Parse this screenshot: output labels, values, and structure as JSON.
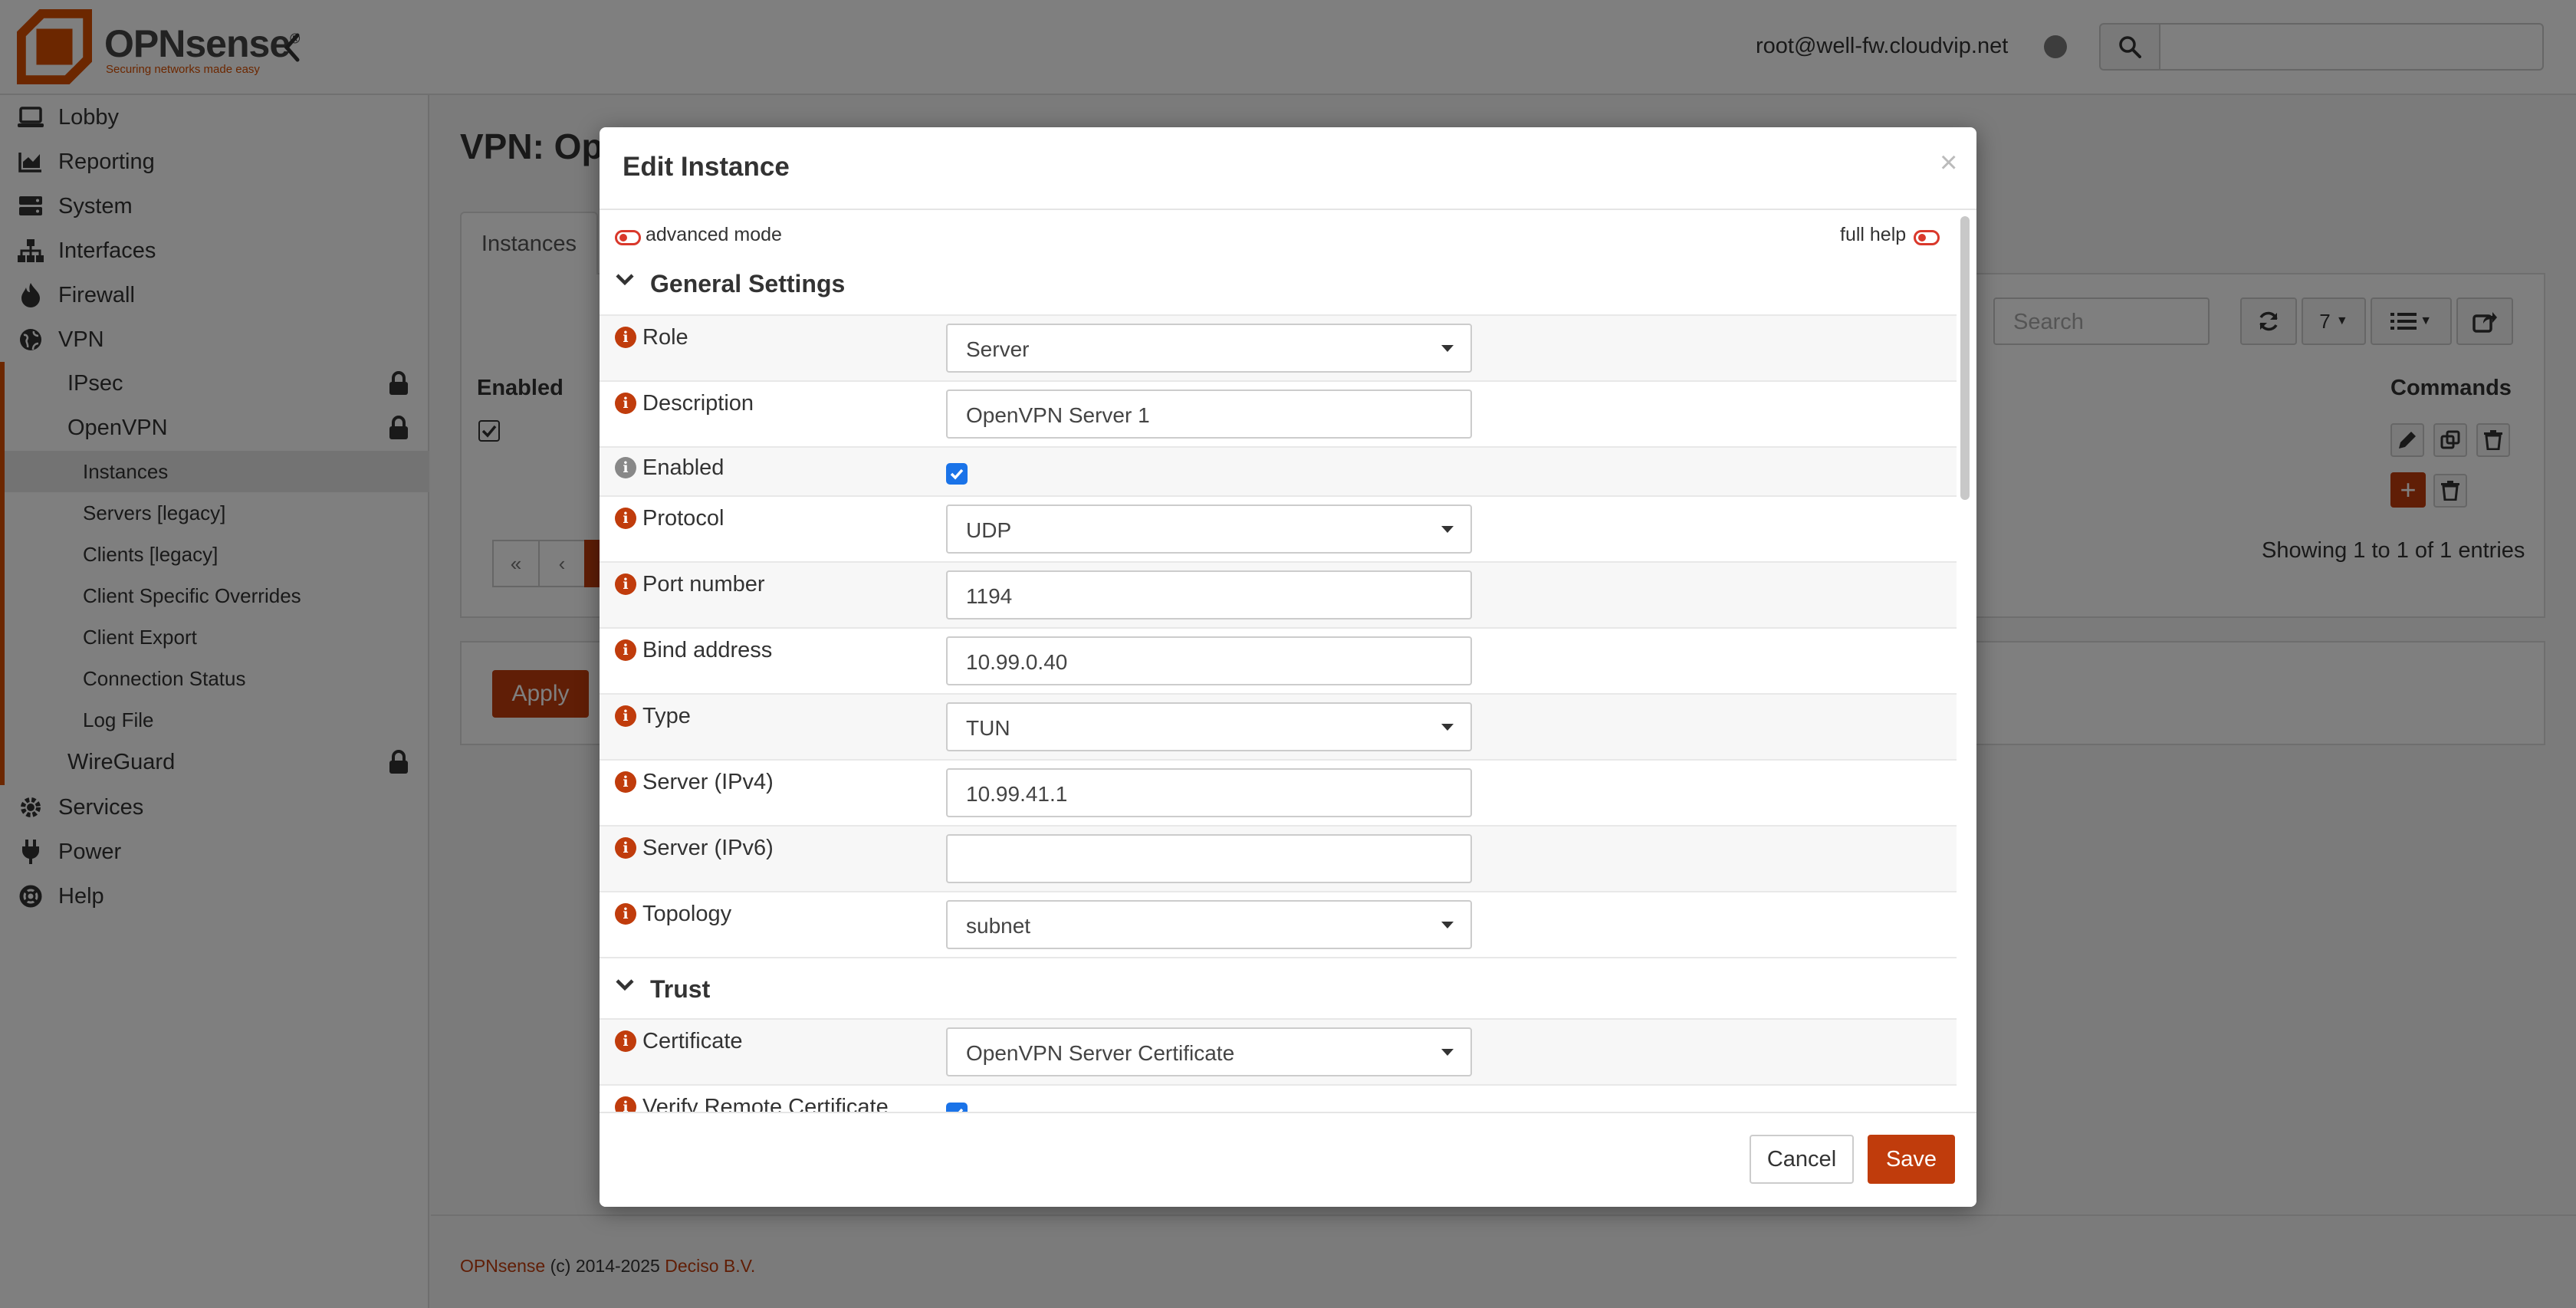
{
  "header": {
    "logo_name": "OPNsense",
    "logo_reg": "®",
    "logo_tagline": "Securing networks made easy",
    "user": "root@well-fw.cloudvip.net"
  },
  "sidebar": {
    "items": [
      {
        "label": "Lobby",
        "icon": "laptop-icon"
      },
      {
        "label": "Reporting",
        "icon": "chart-area-icon"
      },
      {
        "label": "System",
        "icon": "server-icon"
      },
      {
        "label": "Interfaces",
        "icon": "sitemap-icon"
      },
      {
        "label": "Firewall",
        "icon": "fire-icon"
      },
      {
        "label": "VPN",
        "icon": "globe-icon"
      }
    ],
    "vpn_sub": [
      {
        "label": "IPsec",
        "locked": true
      },
      {
        "label": "OpenVPN",
        "locked": true
      }
    ],
    "openvpn_sub": [
      "Instances",
      "Servers [legacy]",
      "Clients [legacy]",
      "Client Specific Overrides",
      "Client Export",
      "Connection Status",
      "Log File"
    ],
    "wireguard": "WireGuard",
    "bottom_items": [
      {
        "label": "Services",
        "icon": "cogs-icon"
      },
      {
        "label": "Power",
        "icon": "plug-icon"
      },
      {
        "label": "Help",
        "icon": "life-ring-icon"
      }
    ]
  },
  "main": {
    "page_title": "VPN: Ope",
    "tab_instances": "Instances",
    "grid_search_placeholder": "Search",
    "page_size": "7",
    "col_enabled": "Enabled",
    "col_commands": "Commands",
    "pager_first": "«",
    "pager_prev": "‹",
    "showing": "Showing 1 to 1 of 1 entries",
    "apply": "Apply"
  },
  "footer": {
    "product": "OPNsense",
    "copyright": "(c) 2014-2025",
    "company": "Deciso B.V."
  },
  "modal": {
    "title": "Edit Instance",
    "close": "×",
    "advanced_mode": "advanced mode",
    "full_help": "full help",
    "sections": {
      "general": "General Settings",
      "trust": "Trust"
    },
    "fields": {
      "role": {
        "label": "Role",
        "value": "Server"
      },
      "description": {
        "label": "Description",
        "value": "OpenVPN Server 1"
      },
      "enabled": {
        "label": "Enabled",
        "checked": true
      },
      "protocol": {
        "label": "Protocol",
        "value": "UDP"
      },
      "port": {
        "label": "Port number",
        "value": "1194"
      },
      "bind": {
        "label": "Bind address",
        "value": "10.99.0.40"
      },
      "type": {
        "label": "Type",
        "value": "TUN"
      },
      "server4": {
        "label": "Server (IPv4)",
        "value": "10.99.41.1"
      },
      "server6": {
        "label": "Server (IPv6)",
        "value": ""
      },
      "topology": {
        "label": "Topology",
        "value": "subnet"
      },
      "certificate": {
        "label": "Certificate",
        "value": "OpenVPN Server Certificate"
      },
      "verify_remote": {
        "label": "Verify Remote Certificate",
        "checked": true
      }
    },
    "cancel": "Cancel",
    "save": "Save"
  },
  "colors": {
    "accent": "#c03c0c",
    "brand": "#d94f00",
    "checkbox": "#1a73e8"
  }
}
